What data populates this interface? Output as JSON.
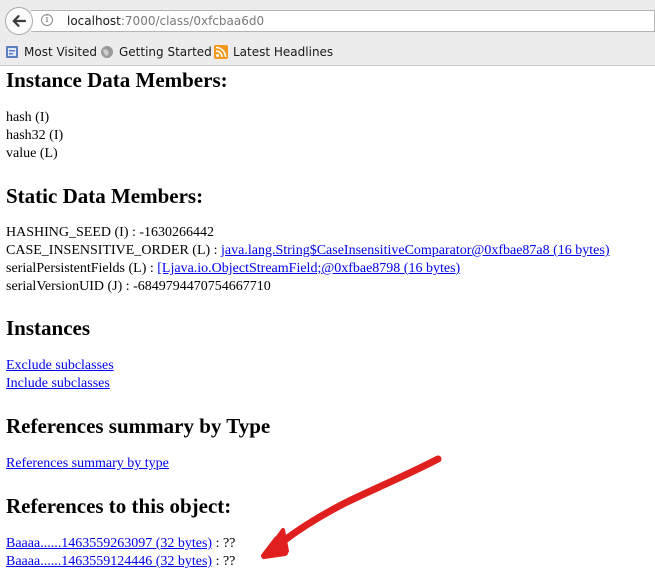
{
  "browser": {
    "url_host": "localhost",
    "url_path": ":7000/class/0xfcbaa6d0",
    "bookmarks": [
      {
        "label": "Most Visited",
        "icon": "bookmark-icon"
      },
      {
        "label": "Getting Started",
        "icon": "globe-icon"
      },
      {
        "label": "Latest Headlines",
        "icon": "rss-icon"
      }
    ]
  },
  "instance_section": {
    "heading": "Instance Data Members:",
    "items": [
      "hash (I)",
      "hash32 (I)",
      "value (L)"
    ]
  },
  "static_section": {
    "heading": "Static Data Members:",
    "items": [
      {
        "prefix": "HASHING_SEED (I) : -1630266442",
        "link": ""
      },
      {
        "prefix": "CASE_INSENSITIVE_ORDER (L) : ",
        "link": "java.lang.String$CaseInsensitiveComparator@0xfbae87a8 (16 bytes)"
      },
      {
        "prefix": "serialPersistentFields (L) : ",
        "link": "[Ljava.io.ObjectStreamField;@0xfbae8798 (16 bytes)"
      },
      {
        "prefix": "serialVersionUID (J) : -6849794470754667710",
        "link": ""
      }
    ]
  },
  "instances_section": {
    "heading": "Instances",
    "links": [
      "Exclude subclasses",
      "Include subclasses"
    ]
  },
  "refsummary_section": {
    "heading": "References summary by Type",
    "link": "References summary by type"
  },
  "refs_section": {
    "heading": "References to this object:",
    "items": [
      {
        "link": "Baaaa......1463559263097 (32 bytes)",
        "suffix": " : ??"
      },
      {
        "link": "Baaaa......1463559124446 (32 bytes)",
        "suffix": " : ??"
      }
    ]
  },
  "annotation": {
    "color": "#e0201e",
    "icon": "red-arrow-annotation"
  }
}
